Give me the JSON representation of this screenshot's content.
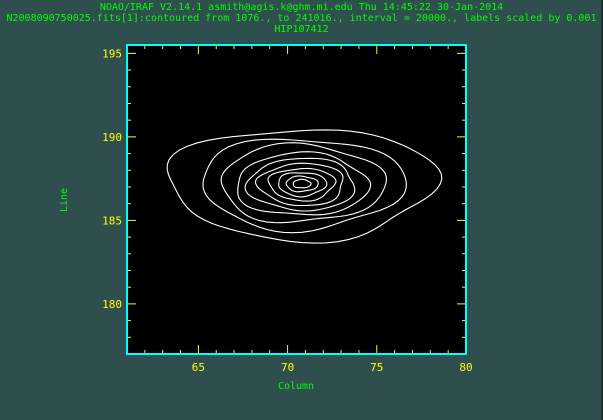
{
  "header": {
    "line1": "NOAO/IRAF V2.14.1 asmith@agis.k@ghm.mi.edu Thu 14:45:22 30-Jan-2014",
    "line2": "N2008090750025.fits[1]:contoured from 1076., to 241016., interval = 20000., labels scaled by 0.001",
    "line3": "HIP107412"
  },
  "colors": {
    "background": "#2f4f4f",
    "frame": "#00ffff",
    "plot_area": "#000000",
    "text": "#00ff00",
    "ticks": "#ffff00",
    "contours": "#ffffff"
  },
  "chart_data": {
    "type": "contour",
    "xlabel": "Column",
    "ylabel": "Line",
    "xlim": [
      61,
      80
    ],
    "ylim": [
      177,
      195.5
    ],
    "xticks": [
      65,
      70,
      75,
      80
    ],
    "yticks": [
      180,
      185,
      190,
      195
    ],
    "center": [
      70.8,
      187.2
    ],
    "levels": [
      {
        "rx": 7.5,
        "ry": 3.3
      },
      {
        "rx": 5.7,
        "ry": 2.7
      },
      {
        "rx": 4.6,
        "ry": 2.3
      },
      {
        "rx": 3.7,
        "ry": 1.85
      },
      {
        "rx": 3.0,
        "ry": 1.55
      },
      {
        "rx": 2.4,
        "ry": 1.25
      },
      {
        "rx": 1.85,
        "ry": 0.95
      },
      {
        "rx": 1.35,
        "ry": 0.7
      },
      {
        "rx": 0.9,
        "ry": 0.45
      },
      {
        "rx": 0.5,
        "ry": 0.25
      }
    ]
  }
}
